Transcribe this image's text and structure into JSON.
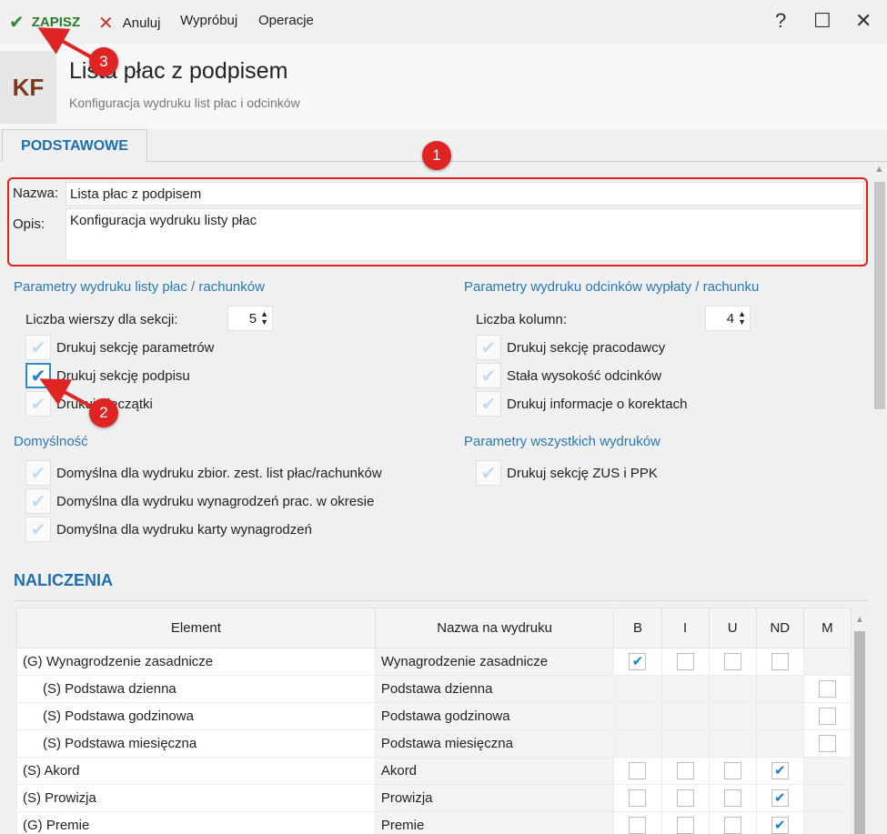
{
  "toolbar": {
    "save_label": "ZAPISZ",
    "cancel_label": "Anuluj",
    "try_label": "Wypróbuj",
    "ops_label": "Operacje",
    "help": "?",
    "maximize": "☐",
    "close": "✕",
    "save_icon": "check-icon",
    "cancel_icon": "x-icon"
  },
  "header": {
    "badge": "KF",
    "title": "Lista płac z podpisem",
    "subtitle": "Konfiguracja wydruku list płac i odcinków"
  },
  "tab": {
    "label": "PODSTAWOWE"
  },
  "form": {
    "name_label": "Nazwa:",
    "name_value": "Lista płac z podpisem",
    "desc_label": "Opis:",
    "desc_value": "Konfiguracja wydruku listy płac"
  },
  "left": {
    "title": "Parametry wydruku listy płac / rachunków",
    "rows_label": "Liczba wierszy dla sekcji:",
    "rows_value": "5",
    "checks": [
      {
        "label": "Drukuj sekcję parametrów",
        "checked": false
      },
      {
        "label": "Drukuj sekcję podpisu",
        "checked": true
      },
      {
        "label": "Drukuj pieczątki",
        "checked": false
      }
    ]
  },
  "right": {
    "title": "Parametry wydruku odcinków wypłaty / rachunku",
    "cols_label": "Liczba kolumn:",
    "cols_value": "4",
    "checks": [
      {
        "label": "Drukuj sekcję pracodawcy",
        "checked": false
      },
      {
        "label": "Stała wysokość odcinków",
        "checked": false
      },
      {
        "label": "Drukuj informacje o korektach",
        "checked": false
      }
    ]
  },
  "defaults": {
    "title": "Domyślność",
    "checks": [
      {
        "label": "Domyślna dla wydruku zbior. zest. list płac/rachunków",
        "checked": false
      },
      {
        "label": "Domyślna dla wydruku wynagrodzeń prac. w okresie",
        "checked": false
      },
      {
        "label": "Domyślna dla wydruku karty wynagrodzeń",
        "checked": false
      }
    ]
  },
  "all_prints": {
    "title": "Parametry wszystkich wydruków",
    "checks": [
      {
        "label": "Drukuj sekcję ZUS i PPK",
        "checked": false
      }
    ]
  },
  "naliczenia": {
    "title": "NALICZENIA",
    "columns": [
      "Element",
      "Nazwa na wydruku",
      "B",
      "I",
      "U",
      "ND",
      "M"
    ],
    "rows": [
      {
        "element": "(G) Wynagrodzenie zasadnicze",
        "print": "Wynagrodzenie zasadnicze",
        "B": "on",
        "I": "off",
        "U": "off",
        "ND": "off",
        "M": "none"
      },
      {
        "element": "(S) Podstawa dzienna",
        "print": "Podstawa dzienna",
        "B": "none",
        "I": "none",
        "U": "none",
        "ND": "none",
        "M": "off"
      },
      {
        "element": "(S) Podstawa godzinowa",
        "print": "Podstawa godzinowa",
        "B": "none",
        "I": "none",
        "U": "none",
        "ND": "none",
        "M": "off"
      },
      {
        "element": "(S) Podstawa miesięczna",
        "print": "Podstawa miesięczna",
        "B": "none",
        "I": "none",
        "U": "none",
        "ND": "none",
        "M": "off"
      },
      {
        "element": "(S) Akord",
        "print": "Akord",
        "B": "off",
        "I": "off",
        "U": "off",
        "ND": "on",
        "M": "none"
      },
      {
        "element": "(S) Prowizja",
        "print": "Prowizja",
        "B": "off",
        "I": "off",
        "U": "off",
        "ND": "on",
        "M": "none"
      },
      {
        "element": "(G) Premie",
        "print": "Premie",
        "B": "off",
        "I": "off",
        "U": "off",
        "ND": "on",
        "M": "none"
      }
    ]
  },
  "annotations": {
    "b1": "1",
    "b2": "2",
    "b3": "3"
  },
  "colors": {
    "accent": "#1f6fb0",
    "annotation": "#e02424",
    "save": "#2e8b2e"
  }
}
